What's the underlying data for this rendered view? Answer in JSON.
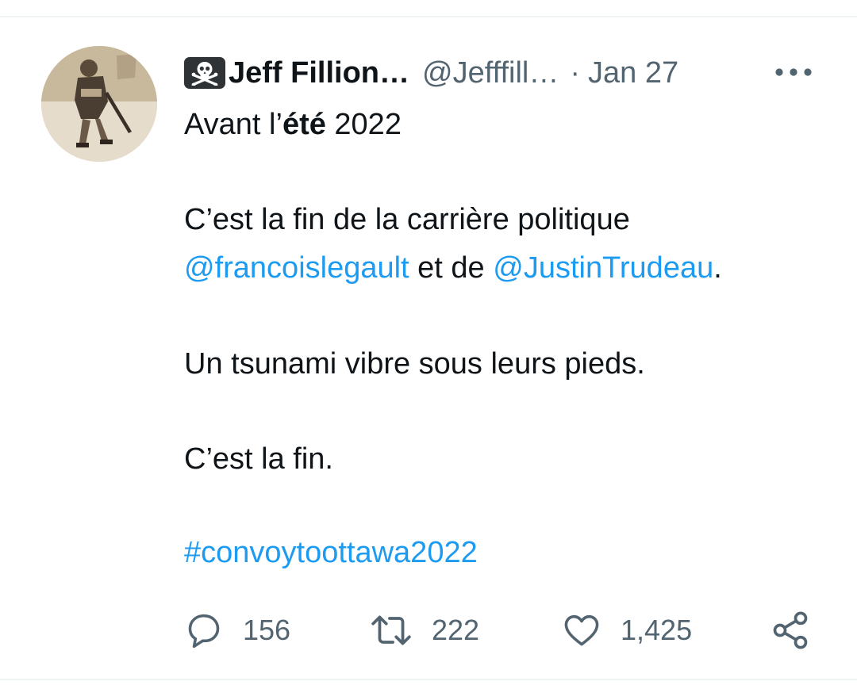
{
  "tweet": {
    "author": {
      "display_name": "Jeff Fillion…",
      "handle": "@Jefffill…",
      "badge_icon": "skull-and-crossbones-icon"
    },
    "separator": "·",
    "date": "Jan 27",
    "more_icon": "more-dots-icon",
    "body": {
      "line1": {
        "prefix": "Avant l’",
        "bold": "été",
        "suffix": " 2022"
      },
      "line2": "C’est la fin de la carrière politique",
      "line3": {
        "mention1": "@francoislegault",
        "middle": " et de ",
        "mention2": "@JustinTrudeau",
        "end": "."
      },
      "line4": "Un tsunami vibre sous leurs pieds.",
      "line5": "C’est la fin.",
      "hashtag": "#convoytoottawa2022"
    },
    "actions": {
      "reply": {
        "icon": "reply-icon",
        "count": "156"
      },
      "retweet": {
        "icon": "retweet-icon",
        "count": "222"
      },
      "like": {
        "icon": "heart-icon",
        "count": "1,425"
      },
      "share": {
        "icon": "share-icon"
      }
    }
  },
  "colors": {
    "link": "#1d9bf0",
    "secondary_text": "#536471",
    "primary_text": "#0f1419",
    "divider": "#eff3f4"
  }
}
